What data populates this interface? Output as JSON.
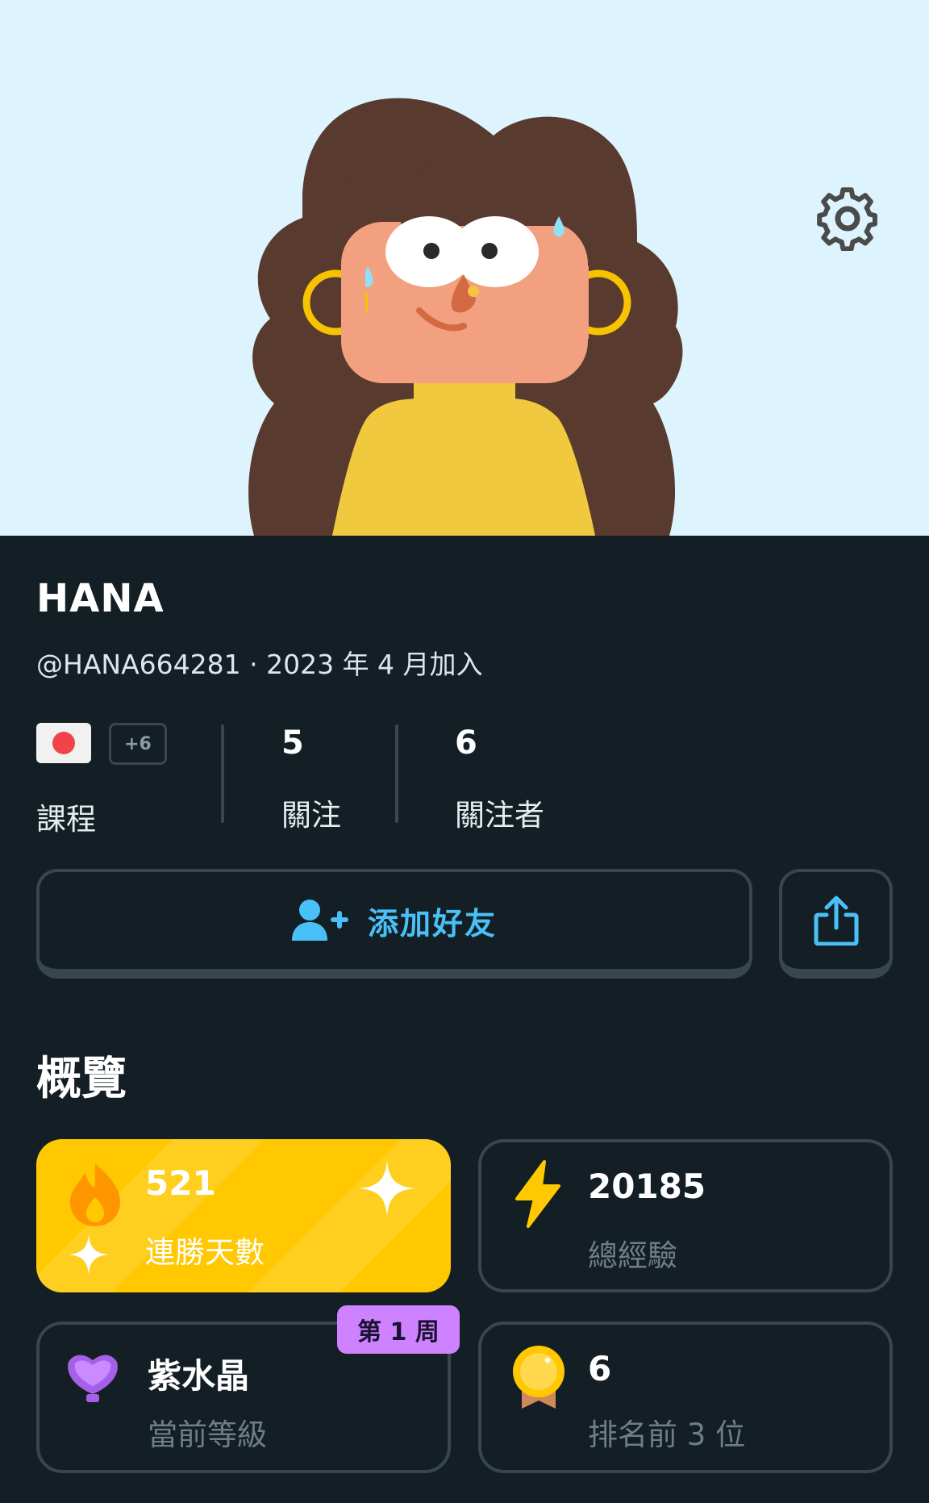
{
  "header": {
    "settings_icon": "gear-icon",
    "background_color": "#ddf4ff"
  },
  "profile": {
    "name": "HANA",
    "handle_joined": "@HANA664281 · 2023 年 4 月加入"
  },
  "stats": {
    "courses_extra": "+6",
    "courses_label": "課程",
    "following_count": "5",
    "following_label": "關注",
    "followers_count": "6",
    "followers_label": "關注者"
  },
  "actions": {
    "add_friend_label": "添加好友",
    "add_friend_icon": "add-user-icon",
    "share_icon": "share-icon",
    "accent_color": "#49c0f8"
  },
  "overview": {
    "title": "概覽",
    "streak_value": "521",
    "streak_label": "連勝天數",
    "xp_value": "20185",
    "xp_label": "總經驗",
    "league_value": "紫水晶",
    "league_label": "當前等級",
    "league_badge": "第 1 周",
    "top3_value": "6",
    "top3_label": "排名前 3 位"
  }
}
